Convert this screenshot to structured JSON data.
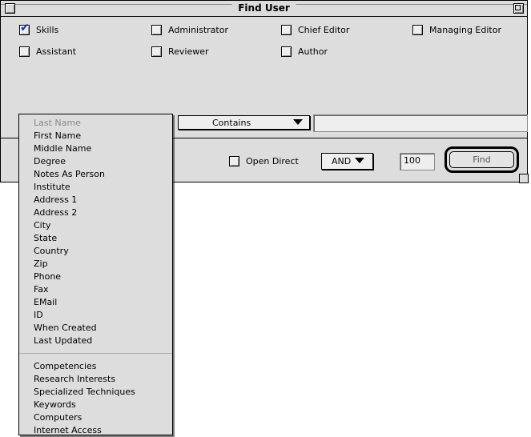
{
  "window": {
    "title": "Find User"
  },
  "roles": [
    {
      "label": "Skills",
      "checked": true
    },
    {
      "label": "Administrator",
      "checked": false
    },
    {
      "label": "Chief Editor",
      "checked": false
    },
    {
      "label": "Managing Editor",
      "checked": false
    },
    {
      "label": "Assistant",
      "checked": false
    },
    {
      "label": "Reviewer",
      "checked": false
    },
    {
      "label": "Author",
      "checked": false
    }
  ],
  "query": {
    "field_selected": "Last Name",
    "operator": "Contains",
    "value": "",
    "open_direct_label": "Open Direct",
    "open_direct_checked": false,
    "logic": "AND",
    "limit": "100",
    "find_label": "Find"
  },
  "menu": {
    "group1": [
      "Last Name",
      "First Name",
      "Middle Name",
      "Degree",
      "Notes As Person",
      "Institute",
      "Address 1",
      "Address 2",
      "City",
      "State",
      "Country",
      "Zip",
      "Phone",
      "Fax",
      "EMail",
      "ID",
      "When Created",
      "Last Updated"
    ],
    "group2": [
      "Competencies",
      "Research Interests",
      "Specialized Techniques",
      "Keywords",
      "Computers",
      "Internet Access"
    ]
  },
  "colors": {
    "check": "#1a2ea8",
    "window_bg": "#dddddd"
  }
}
